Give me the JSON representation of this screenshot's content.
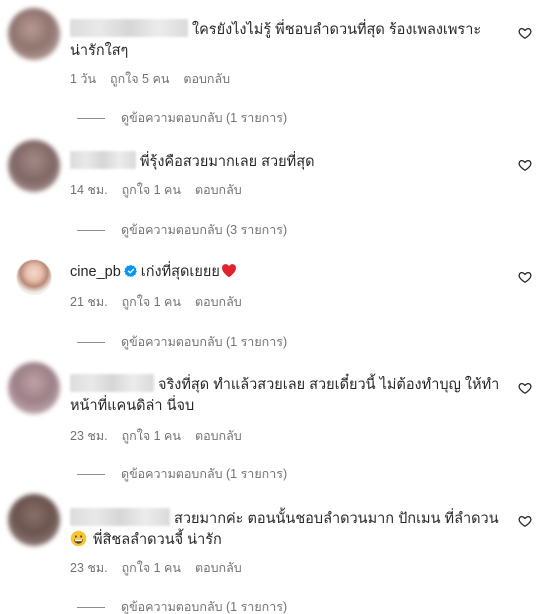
{
  "comments": [
    {
      "text": "ใครยังไงไม่รู้ พี่ชอบลำดวนที่สุด ร้องเพลงเพราะ น่ารักใสๆ",
      "time": "1 วัน",
      "likes": "ถูกใจ 5 คน",
      "reply": "ตอบกลับ",
      "view_replies": "ดูข้อความตอบกลับ (1 รายการ)"
    },
    {
      "text": "พี่รุ้งคือสวยมากเลย สวยที่สุด",
      "time": "14 ชม.",
      "likes": "ถูกใจ 1 คน",
      "reply": "ตอบกลับ",
      "view_replies": "ดูข้อความตอบกลับ (3 รายการ)"
    },
    {
      "username": "cine_pb",
      "text": "เก่งที่สุดเยยย",
      "time": "21 ชม.",
      "likes": "ถูกใจ 1 คน",
      "reply": "ตอบกลับ",
      "view_replies": "ดูข้อความตอบกลับ (1 รายการ)"
    },
    {
      "text": "จริงที่สุด ทำแล้วสวยเลย สวยเดี๋ยวนี้ ไม่ต้องทำบุญ ให้ทำหน้าที่แคนดิล่า นี่จบ",
      "time": "23 ชม.",
      "likes": "ถูกใจ 1 คน",
      "reply": "ตอบกลับ",
      "view_replies": "ดูข้อความตอบกลับ (1 รายการ)"
    },
    {
      "text": "สวยมากค่ะ ตอนนั้นชอบลำดวนมาก ปักเมน ที่ลำดวน",
      "text_line2": "พี่สิชลลำดวนจี้ น่ารัก",
      "time": "23 ชม.",
      "likes": "ถูกใจ 1 คน",
      "reply": "ตอบกลับ",
      "view_replies": "ดูข้อความตอบกลับ (1 รายการ)"
    }
  ],
  "icons": {
    "like": "heart-outline-icon",
    "verified": "verified-badge-icon",
    "heart_emoji": "red-heart-emoji",
    "emoji": "grinning-face-emoji"
  },
  "colors": {
    "text": "#262626",
    "secondary": "#737373",
    "verified": "#0095f6",
    "heart": "#ed4956"
  }
}
